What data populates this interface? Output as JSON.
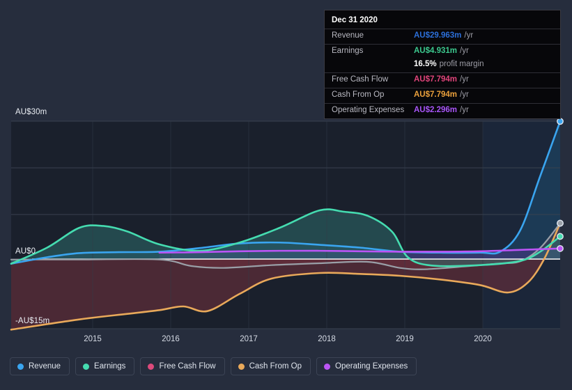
{
  "chart_data": {
    "type": "area",
    "title": "",
    "xlabel": "",
    "ylabel": "",
    "currency": "AU$",
    "grid": true,
    "legend_position": "bottom-left",
    "xlim": [
      "2014.15",
      "2021.00"
    ],
    "ylim": [
      -15,
      30
    ],
    "x_ticks": [
      "2015",
      "2016",
      "2017",
      "2018",
      "2019",
      "2020"
    ],
    "y_ticks": [
      "AU$30m",
      "AU$0",
      "-AU$15m"
    ],
    "y_tick_values": [
      30,
      0,
      -15
    ],
    "forecast_band_start": "2020",
    "series": [
      {
        "name": "Revenue",
        "color": "#3aa5f0",
        "fill": "#1d4a6e",
        "x": [
          2014.15,
          2014.6,
          2015.0,
          2015.5,
          2016.0,
          2016.5,
          2017.0,
          2017.5,
          2018.0,
          2018.5,
          2019.0,
          2019.5,
          2020.0,
          2020.25,
          2020.5,
          2020.75,
          2021.0
        ],
        "values": [
          -1.0,
          0.4,
          1.3,
          1.5,
          1.6,
          2.4,
          3.4,
          3.6,
          3.1,
          2.5,
          1.6,
          1.4,
          1.4,
          1.6,
          6.2,
          18.0,
          29.963
        ]
      },
      {
        "name": "Earnings",
        "color": "#45dcb0",
        "fill": "#2d6b6b",
        "x": [
          2014.15,
          2014.6,
          2015.0,
          2015.3,
          2015.6,
          2016.0,
          2016.5,
          2017.0,
          2017.5,
          2018.0,
          2018.3,
          2018.6,
          2018.9,
          2019.1,
          2019.4,
          2020.0,
          2020.5,
          2020.75,
          2021.0
        ],
        "values": [
          -1.0,
          2.5,
          6.8,
          7.2,
          6.0,
          3.2,
          1.8,
          3.6,
          6.8,
          10.6,
          10.3,
          9.4,
          6.0,
          0.4,
          -1.4,
          -1.3,
          -0.4,
          1.6,
          4.931
        ]
      },
      {
        "name": "Free Cash Flow",
        "color": "#9aa0a8",
        "fill": "#6b2f3c",
        "x": [
          2014.15,
          2015.0,
          2016.0,
          2016.4,
          2016.8,
          2017.4,
          2018.0,
          2018.6,
          2019.0,
          2019.3,
          2019.8,
          2020.2,
          2020.5,
          2020.75,
          2021.0
        ],
        "values": [
          -0.1,
          -0.1,
          -0.1,
          -1.5,
          -1.9,
          -1.3,
          -0.9,
          -0.6,
          -1.9,
          -2.2,
          -1.6,
          -1.0,
          -0.5,
          2.4,
          7.794
        ]
      },
      {
        "name": "Cash From Op",
        "color": "#e9a95a",
        "fill": "#6b2f3c",
        "x": [
          2014.15,
          2015.0,
          2015.6,
          2016.0,
          2016.3,
          2016.6,
          2017.0,
          2017.4,
          2018.0,
          2018.5,
          2019.0,
          2019.5,
          2020.0,
          2020.35,
          2020.6,
          2020.8,
          2021.0
        ],
        "values": [
          -15.2,
          -13.0,
          -11.8,
          -11.0,
          -10.2,
          -11.2,
          -7.5,
          -4.2,
          -3.0,
          -3.2,
          -3.6,
          -4.4,
          -5.6,
          -7.2,
          -5.0,
          0.0,
          7.794
        ]
      },
      {
        "name": "Operating Expenses",
        "color": "#bb55f5",
        "fill": "#4b3a86",
        "x": [
          2016.0,
          2016.5,
          2017.0,
          2017.5,
          2018.0,
          2018.5,
          2019.0,
          2019.5,
          2020.0,
          2020.5,
          2021.0
        ],
        "values": [
          1.4,
          1.5,
          1.7,
          1.8,
          1.8,
          1.7,
          1.6,
          1.6,
          1.7,
          2.0,
          2.296
        ]
      }
    ]
  },
  "tooltip": {
    "date": "Dec 31 2020",
    "rows": [
      {
        "label": "Revenue",
        "value": "AU$29.963m",
        "unit": "/yr",
        "color": "#2c6fd8"
      },
      {
        "label": "Earnings",
        "value": "AU$4.931m",
        "unit": "/yr",
        "color": "#3cc98e"
      },
      {
        "label": "Free Cash Flow",
        "value": "AU$7.794m",
        "unit": "/yr",
        "color": "#e0447a"
      },
      {
        "label": "Cash From Op",
        "value": "AU$7.794m",
        "unit": "/yr",
        "color": "#eaa03c"
      },
      {
        "label": "Operating Expenses",
        "value": "AU$2.296m",
        "unit": "/yr",
        "color": "#a855f7"
      }
    ],
    "margin_value": "16.5%",
    "margin_text": "profit margin"
  },
  "legend": {
    "items": [
      {
        "label": "Revenue",
        "color": "#3aa5f0"
      },
      {
        "label": "Earnings",
        "color": "#45dcb0"
      },
      {
        "label": "Free Cash Flow",
        "color": "#dc4a7b"
      },
      {
        "label": "Cash From Op",
        "color": "#e9a95a"
      },
      {
        "label": "Operating Expenses",
        "color": "#bb55f5"
      }
    ]
  }
}
